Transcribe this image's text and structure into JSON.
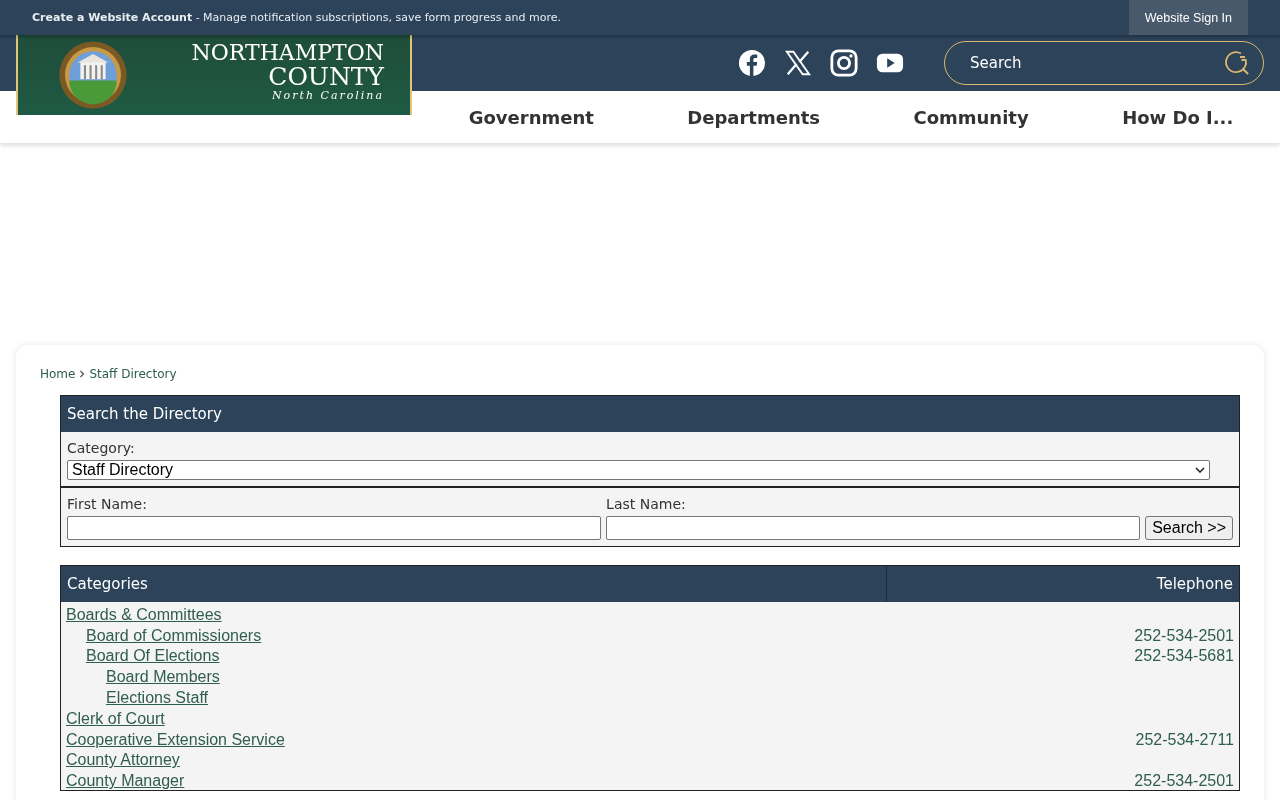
{
  "top_bar": {
    "title": "Create a Website Account",
    "text": " - Manage notification subscriptions, save form progress and more.",
    "sign_in": "Website Sign In"
  },
  "logo": {
    "line_1": "NORTHAMPTON",
    "line_2": "COUNTY",
    "line_3": "North Carolina"
  },
  "search": {
    "placeholder": "Search"
  },
  "nav": [
    {
      "label": "Government"
    },
    {
      "label": "Departments"
    },
    {
      "label": "Community"
    },
    {
      "label": "How Do I..."
    }
  ],
  "breadcrumb": [
    "Home",
    "Staff Directory"
  ],
  "directory_search": {
    "title": "Search the Directory",
    "category_label": "Category:",
    "category_value": "Staff Directory",
    "first_name_label": "First Name:",
    "last_name_label": "Last Name:",
    "button": "Search >>"
  },
  "table": {
    "columns": [
      "Categories",
      "Telephone"
    ],
    "rows": [
      {
        "name": "Boards & Committees",
        "children": [
          {
            "name": "Board of Commissioners",
            "phone": "252-534-2501"
          },
          {
            "name": "Board Of Elections",
            "phone": "252-534-5681",
            "children": [
              {
                "name": "Board Members"
              },
              {
                "name": "Elections Staff"
              }
            ]
          }
        ]
      },
      {
        "name": "Clerk of Court"
      },
      {
        "name": "Cooperative Extension Service",
        "phone": "252-534-2711"
      },
      {
        "name": "County Attorney"
      },
      {
        "name": "County Manager",
        "phone": "252-534-2501"
      }
    ]
  }
}
